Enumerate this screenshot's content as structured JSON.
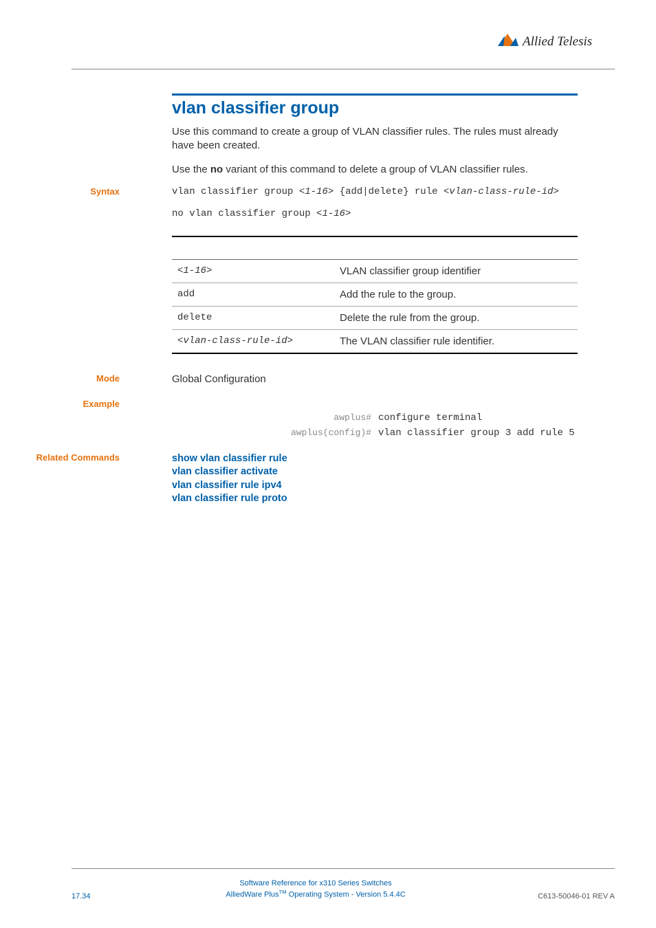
{
  "brand": "Allied Telesis",
  "title": "vlan classifier group",
  "intro": {
    "p1a": "Use this command to create a group of VLAN classifier rules. The rules must already have been created.",
    "p2a": "Use the ",
    "p2b": "no",
    "p2c": " variant of this command to delete a group of VLAN classifier rules."
  },
  "labels": {
    "syntax": "Syntax",
    "mode": "Mode",
    "example": "Example",
    "related": "Related Commands"
  },
  "syntax": {
    "line1_pre": "vlan classifier group ",
    "line1_arg1": "<1-16>",
    "line1_mid": " {add|delete} rule ",
    "line1_arg2": "<vlan-class-rule-id>",
    "line2_pre": "no vlan classifier group ",
    "line2_arg1": "<1-16>"
  },
  "params": [
    {
      "p": "<1-16>",
      "p_italic": true,
      "d": "VLAN classifier group identifier"
    },
    {
      "p": "add",
      "p_italic": false,
      "d": "Add the rule to the group."
    },
    {
      "p": "delete",
      "p_italic": false,
      "d": "Delete the rule from the group."
    },
    {
      "p": "<vlan-class-rule-id>",
      "p_italic": true,
      "d": "The VLAN classifier rule identifier."
    }
  ],
  "mode": "Global Configuration",
  "example": [
    {
      "prompt": "awplus#",
      "cmd": "configure terminal"
    },
    {
      "prompt": "awplus(config)#",
      "cmd": "vlan classifier group 3 add rule 5"
    }
  ],
  "related": [
    "show vlan classifier rule",
    "vlan classifier activate",
    "vlan classifier rule ipv4",
    "vlan classifier rule proto"
  ],
  "footer": {
    "left": "17.34",
    "c1": "Software Reference for x310 Series Switches",
    "c2a": "AlliedWare Plus",
    "c2b": "TM",
    "c2c": " Operating System  - Version 5.4.4C",
    "right": "C613-50046-01 REV A"
  }
}
